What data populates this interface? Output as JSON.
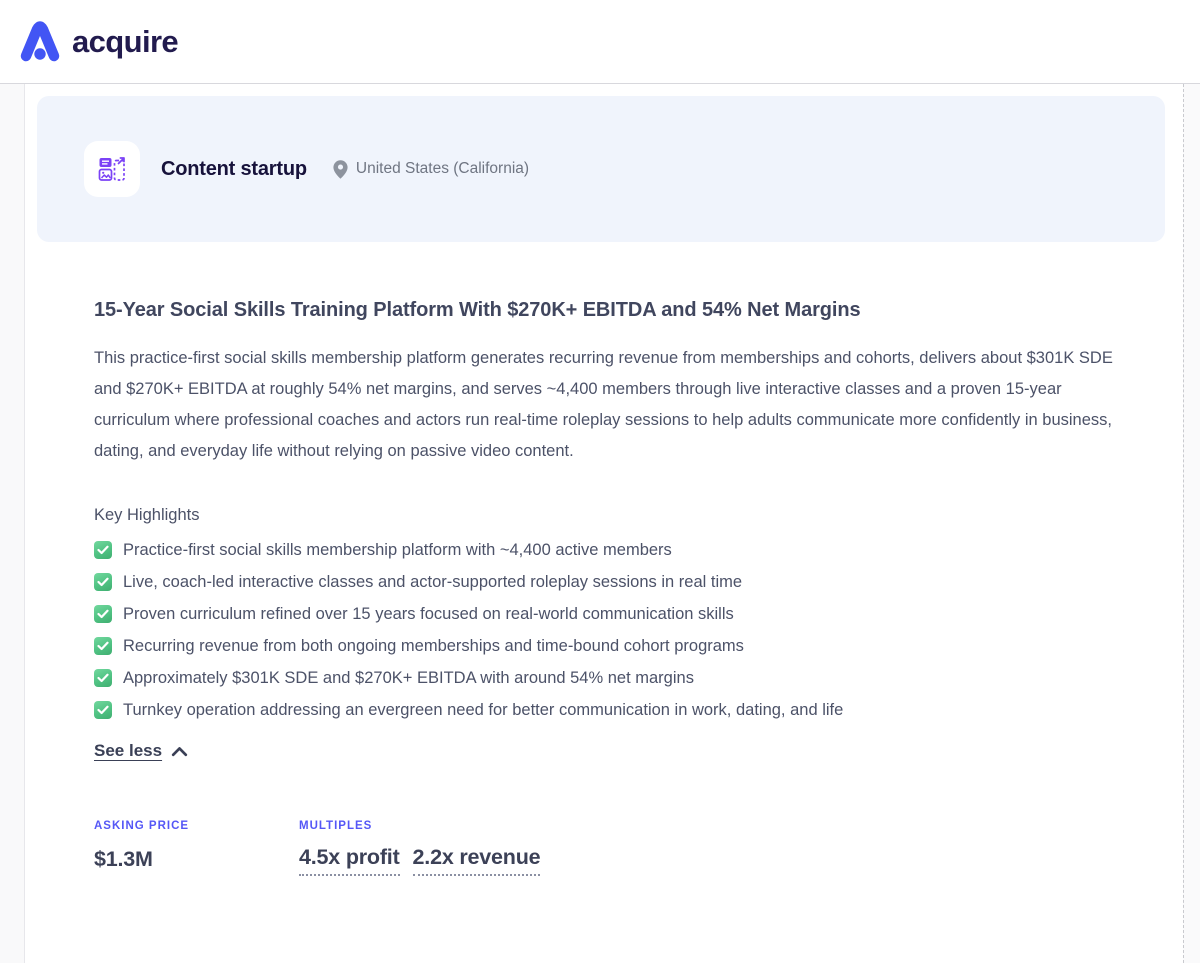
{
  "colors": {
    "brand_blue": "#4255F4",
    "brand_navy": "#221B4E",
    "accent_purple": "#7B42F6",
    "label_purple": "#5557F6",
    "check_green": "#4DBD7D",
    "banner_bg": "#F0F4FC"
  },
  "header": {
    "logo_text": "acquire"
  },
  "listing": {
    "type_label": "Content startup",
    "location": "United States (California)",
    "headline": "15-Year Social Skills Training Platform With $270K+ EBITDA and 54% Net Margins",
    "description": "This practice-first social skills membership platform generates recurring revenue from memberships and cohorts, delivers about $301K SDE and $270K+ EBITDA at roughly 54% net margins, and serves ~4,400 members through live interactive classes and a proven 15-year curriculum where professional coaches and actors run real-time roleplay sessions to help adults communicate more confidently in business, dating, and everyday life without relying on passive video content.",
    "highlights_title": "Key Highlights",
    "highlights": [
      "Practice-first social skills membership platform with ~4,400 active members",
      "Live, coach-led interactive classes and actor-supported roleplay sessions in real time",
      "Proven curriculum refined over 15 years focused on real-world communication skills",
      "Recurring revenue from both ongoing memberships and time-bound cohort programs",
      "Approximately $301K SDE and $270K+ EBITDA with around 54% net margins",
      "Turnkey operation addressing an evergreen need for better communication in work, dating, and life"
    ],
    "see_less_label": "See less",
    "asking_price": {
      "label": "ASKING PRICE",
      "value": "$1.3M"
    },
    "multiples": {
      "label": "MULTIPLES",
      "profit": "4.5x profit",
      "revenue": "2.2x revenue"
    }
  },
  "icons": {
    "logo_mark": "acquire-a-mark",
    "listing_type": "content-blocks-icon",
    "location": "map-pin-icon",
    "highlight_check": "check-icon",
    "see_less": "chevron-up-icon"
  }
}
